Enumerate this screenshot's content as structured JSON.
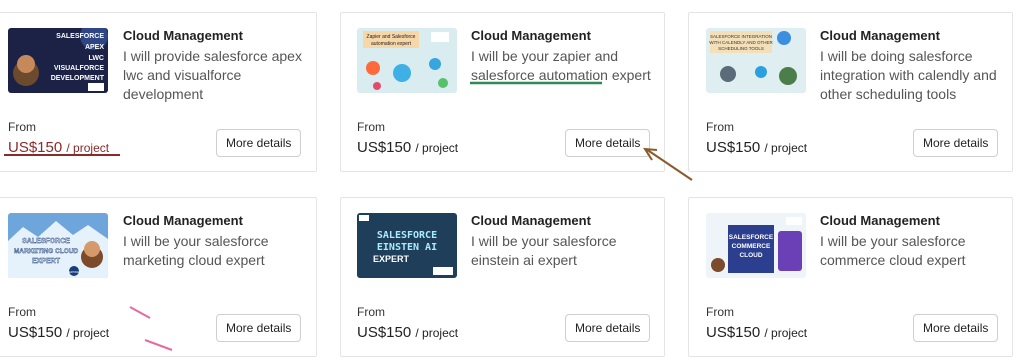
{
  "cards": [
    {
      "category": "Cloud Management",
      "description": "I will provide salesforce apex lwc and visualforce development",
      "from_label": "From",
      "price": "US$150",
      "unit": "/ project",
      "button": "More details",
      "thumb": {
        "lines": [
          "SALESFORCE",
          "APEX",
          "LWC",
          "VISUALFORCE",
          "DEVELOPMENT"
        ],
        "bg": "#1c2245"
      }
    },
    {
      "category": "Cloud Management",
      "description": "I will be your zapier and salesforce automation expert",
      "from_label": "From",
      "price": "US$150",
      "unit": "/ project",
      "button": "More details",
      "thumb": {
        "lines": [
          "Zapier and Salesforce",
          "automation expert"
        ],
        "bg": "#d9ecf0"
      }
    },
    {
      "category": "Cloud Management",
      "description": "I will be doing salesforce integration with calendly and other scheduling tools",
      "from_label": "From",
      "price": "US$150",
      "unit": "/ project",
      "button": "More details",
      "thumb": {
        "lines": [
          "SALESFORCE INTEGRATION",
          "WITH CALENDLY AND OTHER",
          "SCHEDULING TOOLS"
        ],
        "bg": "#dfeef1"
      }
    },
    {
      "category": "Cloud Management",
      "description": "I will be your salesforce marketing cloud expert",
      "from_label": "From",
      "price": "US$150",
      "unit": "/ project",
      "button": "More details",
      "thumb": {
        "lines": [
          "SALESFORCE",
          "MARKETING CLOUD",
          "EXPERT",
          "CERTIFIED"
        ],
        "bg": "#6ea6db"
      }
    },
    {
      "category": "Cloud Management",
      "description": "I will be your salesforce einstein ai expert",
      "from_label": "From",
      "price": "US$150",
      "unit": "/ project",
      "button": "More details",
      "thumb": {
        "lines": [
          "SALESFORCE",
          "EINSTEN AI",
          "EXPERT"
        ],
        "bg": "#1f3e5a"
      }
    },
    {
      "category": "Cloud Management",
      "description": "I will be your salesforce commerce cloud expert",
      "from_label": "From",
      "price": "US$150",
      "unit": "/ project",
      "button": "More details",
      "thumb": {
        "lines": [
          "SALESFORCE",
          "COMMERCE",
          "CLOUD"
        ],
        "bg": "#eef4f8"
      }
    }
  ],
  "colors": {
    "border": "#e4e4e4",
    "text": "#222222",
    "muted": "#555555",
    "annotation_red": "#8b2a2a",
    "annotation_green": "#2f8a55",
    "annotation_brown": "#8b5a2b",
    "annotation_pink": "#e56aa0"
  }
}
